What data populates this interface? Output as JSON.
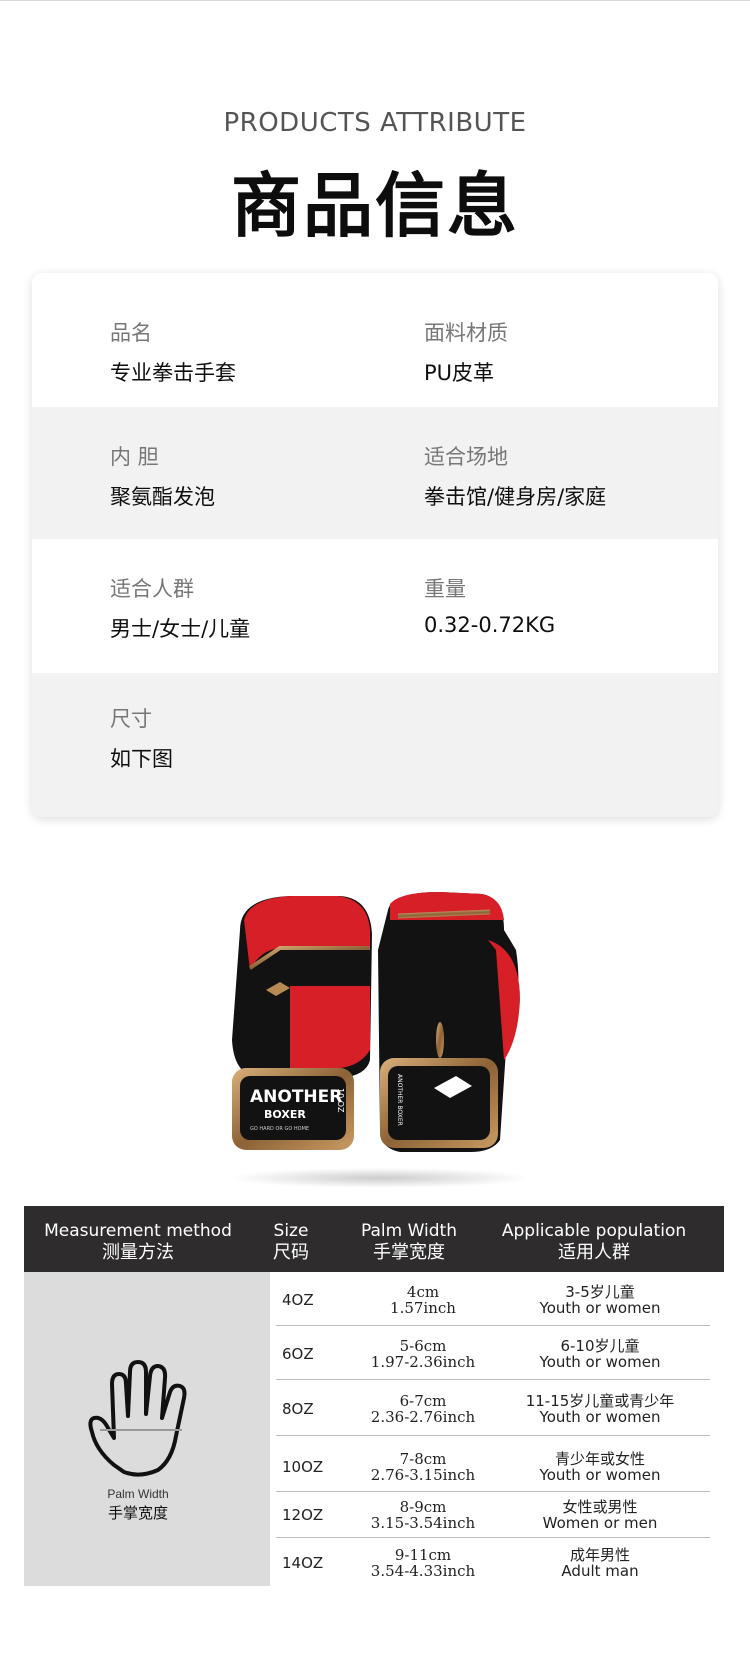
{
  "header": {
    "subtitle_en": "PRODUCTS ATTRIBUTE",
    "title_cn": "商品信息"
  },
  "attributes": [
    [
      {
        "label": "品名",
        "value": "专业拳击手套"
      },
      {
        "label": "面料材质",
        "value": "PU皮革"
      }
    ],
    [
      {
        "label": "内 胆",
        "value": "聚氨酯发泡"
      },
      {
        "label": "适合场地",
        "value": "拳击馆/健身房/家庭"
      }
    ],
    [
      {
        "label": "适合人群",
        "value": "男士/女士/儿童"
      },
      {
        "label": "重量",
        "value": "0.32-0.72KG"
      }
    ],
    [
      {
        "label": "尺寸",
        "value": "如下图"
      }
    ]
  ],
  "product_image": {
    "brand_text": "ANOTHER BOXER",
    "tagline": "GO HARD OR GO HOME",
    "size_mark": "10 OZ",
    "colors": {
      "red": "#d61f26",
      "black": "#121212",
      "gold": "#b68a52"
    }
  },
  "size_chart": {
    "headers": {
      "method": {
        "en": "Measurement method",
        "cn": "测量方法"
      },
      "size": {
        "en": "Size",
        "cn": "尺码"
      },
      "palm": {
        "en": "Palm Width",
        "cn": "手掌宽度"
      },
      "population": {
        "en": "Applicable population",
        "cn": "适用人群"
      }
    },
    "hand_caption_en": "Palm Width",
    "hand_caption_cn": "手掌宽度",
    "rows": [
      {
        "size": "4OZ",
        "cm": "4cm",
        "inch": "1.57inch",
        "pop_cn": "3-5岁儿童",
        "pop_en": "Youth or women"
      },
      {
        "size": "6OZ",
        "cm": "5-6cm",
        "inch": "1.97-2.36inch",
        "pop_cn": "6-10岁儿童",
        "pop_en": "Youth or women"
      },
      {
        "size": "8OZ",
        "cm": "6-7cm",
        "inch": "2.36-2.76inch",
        "pop_cn": "11-15岁儿童或青少年",
        "pop_en": "Youth or women"
      },
      {
        "size": "10OZ",
        "cm": "7-8cm",
        "inch": "2.76-3.15inch",
        "pop_cn": "青少年或女性",
        "pop_en": "Youth or women"
      },
      {
        "size": "12OZ",
        "cm": "8-9cm",
        "inch": "3.15-3.54inch",
        "pop_cn": "女性或男性",
        "pop_en": "Women or men"
      },
      {
        "size": "14OZ",
        "cm": "9-11cm",
        "inch": "3.54-4.33inch",
        "pop_cn": "成年男性",
        "pop_en": "Adult man"
      }
    ],
    "colors": {
      "header_bg": "#2e2c2d",
      "panel_bg": "#dcdcdc"
    }
  }
}
